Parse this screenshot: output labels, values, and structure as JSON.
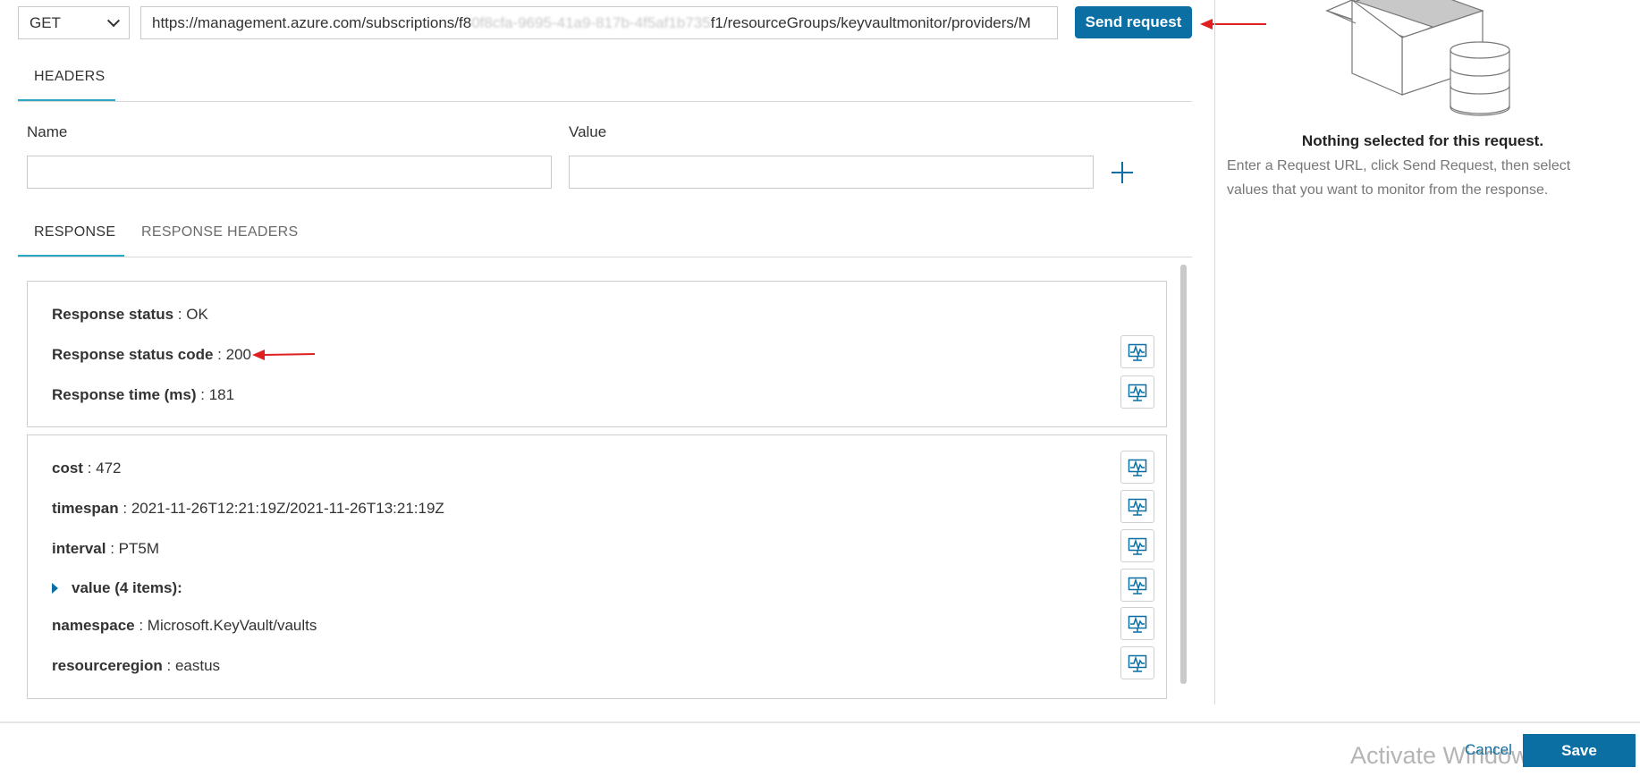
{
  "request": {
    "method": "GET",
    "url_prefix": "https://management.azure.com/subscriptions/f8",
    "url_blurred": "0f8cfa-9695-41a9-817b-4f5af1b735",
    "url_suffix": "f1/resourceGroups/keyvaultmonitor/providers/M",
    "send_label": "Send request"
  },
  "headers_tab": {
    "label": "HEADERS"
  },
  "headers": {
    "name_label": "Name",
    "value_label": "Value",
    "name_value": "",
    "value_value": ""
  },
  "response_tabs": [
    {
      "label": "RESPONSE",
      "active": true
    },
    {
      "label": "RESPONSE HEADERS",
      "active": false
    }
  ],
  "status_panel": {
    "rows": [
      {
        "key": "Response status",
        "value": "OK"
      },
      {
        "key": "Response status code",
        "value": "200"
      },
      {
        "key": "Response time (ms)",
        "value": "181"
      }
    ]
  },
  "body_panel": {
    "rows": [
      {
        "key": "cost",
        "value": "472"
      },
      {
        "key": "timespan",
        "value": "2021-11-26T12:21:19Z/2021-11-26T13:21:19Z"
      },
      {
        "key": "interval",
        "value": "PT5M"
      },
      {
        "key": "value (4 items):",
        "value": ""
      },
      {
        "key": "namespace",
        "value": "Microsoft.KeyVault/vaults"
      },
      {
        "key": "resourceregion",
        "value": "eastus"
      }
    ]
  },
  "sidebar": {
    "title": "Nothing selected for this request.",
    "description": "Enter a Request URL, click Send Request, then select values that you want to monitor from the response."
  },
  "footer": {
    "watermark": "Activate Windows",
    "cancel_label": "Cancel",
    "save_label": "Save"
  },
  "colors": {
    "accent": "#0b6fa4",
    "tab_underline": "#2aa8c4",
    "annotation_arrow": "#e02020"
  }
}
